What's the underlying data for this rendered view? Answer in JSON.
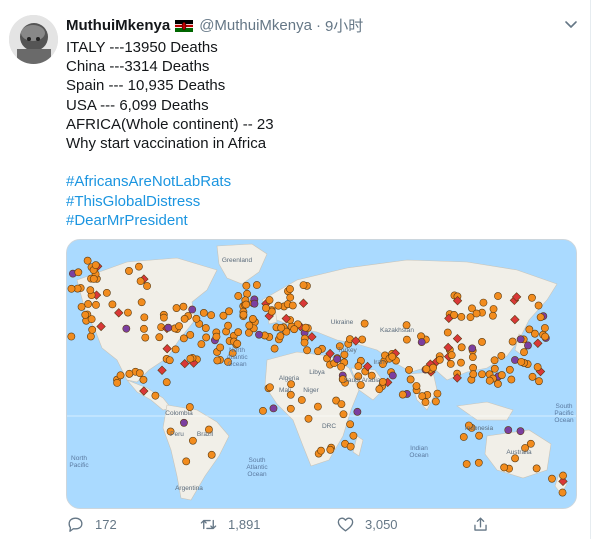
{
  "tweet": {
    "author_name": "MuthuiMkenya",
    "author_handle": "@MuthuiMkenya",
    "separator": "·",
    "timestamp": "9小时",
    "lines": [
      "ITALY ---13950 Deaths",
      "China ---3314 Deaths",
      "Spain --- 10,935 Deaths",
      "USA --- 6,099 Deaths",
      "AFRICA(Whole continent) -- 23",
      "Why start vaccination in Africa"
    ],
    "hashtags": [
      "#AfricansAreNotLabRats",
      "#ThisGlobalDistress",
      "#DearMrPresident"
    ]
  },
  "map": {
    "labels": {
      "greenland": "Greenland",
      "north_atlantic": "North\nAtlantic\nOcean",
      "south_atlantic": "South\nAtlantic\nOcean",
      "north_pacific": "North\nPacific",
      "south_pacific": "South\nPacific\nOcean",
      "indian_ocean": "Indian\nOcean",
      "kazakhstan": "Kazakhstan",
      "ukraine": "Ukraine",
      "turkey": "Turkey",
      "iran": "Iran",
      "saudi_arabia": "Saudi Arabia",
      "libya": "Libya",
      "algeria": "Algeria",
      "mali": "Mali",
      "niger": "Niger",
      "drc": "DRC",
      "colombia": "Colombia",
      "peru": "Peru",
      "brazil": "Brazil",
      "argentina": "Argentina",
      "australia": "Australia",
      "indonesia": "Indonesia"
    },
    "colors": {
      "ocean": "#aadaff",
      "land": "#f1efe8",
      "marker": "#f28c1e",
      "marker_red": "#d93838",
      "marker_purple": "#7b3fa0"
    }
  },
  "actions": {
    "reply_count": "172",
    "retweet_count": "1,891",
    "like_count": "3,050"
  }
}
